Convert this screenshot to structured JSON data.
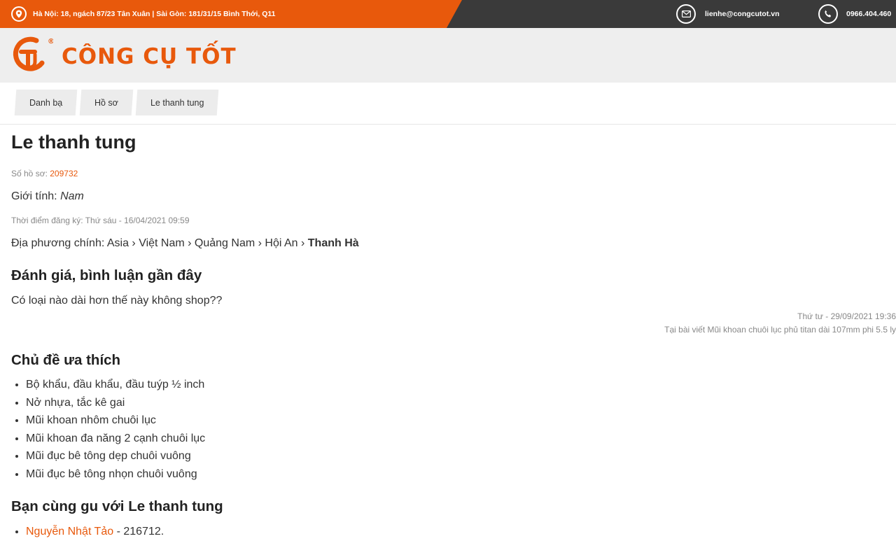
{
  "topbar": {
    "address": "Hà Nội: 18, ngách 87/23 Tân Xuân | Sài Gòn: 181/31/15 Bình Thới, Q11",
    "email": "lienhe@congcutot.vn",
    "phone": "0966.404.460",
    "icons": [
      "location-pin-icon",
      "mail-icon",
      "phone-icon"
    ]
  },
  "brand": {
    "logo_mark": "CT",
    "name": "CÔNG CỤ TỐT",
    "registered": "®",
    "color": "#e8590c"
  },
  "breadcrumbs": [
    "Danh bạ",
    "Hồ sơ",
    "Le thanh tung"
  ],
  "profile": {
    "name": "Le thanh tung",
    "id_label": "Số hồ sơ:",
    "id": "209732",
    "gender_label": "Giới tính:",
    "gender": "Nam",
    "registered": "Thời điểm đăng ký: Thứ sáu - 16/04/2021 09:59",
    "location_label": "Địa phương chính:",
    "location_path": "Asia › Việt Nam › Quảng Nam › Hội An ›",
    "location_last": "Thanh Hà"
  },
  "reviews": {
    "heading": "Đánh giá, bình luận gần đây",
    "items": [
      {
        "text": "Có loại nào dài hơn thế này không shop??",
        "date": "Thứ tư - 29/09/2021 19:36",
        "post": "Tại bài viết Mũi khoan chuôi lục phủ titan dài 107mm phi 5.5 ly"
      }
    ]
  },
  "favorites": {
    "heading": "Chủ đề ưa thích",
    "items": [
      "Bộ khẩu, đầu khẩu, đầu tuýp ½ inch",
      "Nở nhựa, tắc kê gai",
      "Mũi khoan nhôm chuôi lục",
      "Mũi khoan đa năng 2 cạnh chuôi lục",
      "Mũi đục bê tông dẹp chuôi vuông",
      "Mũi đục bê tông nhọn chuôi vuông"
    ]
  },
  "similar": {
    "heading": "Bạn cùng gu với Le thanh tung",
    "items": [
      {
        "name": "Nguyễn Nhật Tảo",
        "suffix": " - 216712."
      }
    ]
  }
}
